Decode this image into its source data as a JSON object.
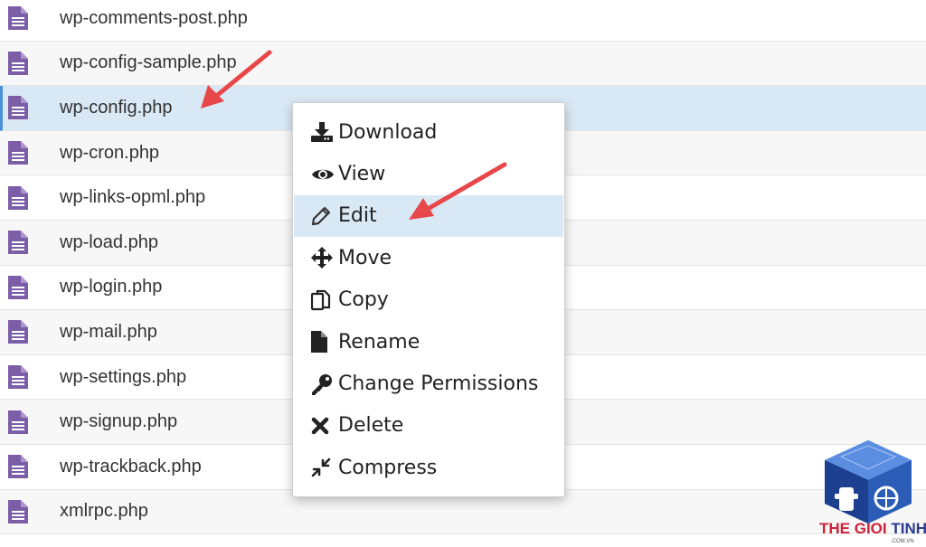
{
  "files": [
    {
      "name": "wp-comments-post.php",
      "selected": false
    },
    {
      "name": "wp-config-sample.php",
      "selected": false
    },
    {
      "name": "wp-config.php",
      "selected": true
    },
    {
      "name": "wp-cron.php",
      "selected": false
    },
    {
      "name": "wp-links-opml.php",
      "selected": false
    },
    {
      "name": "wp-load.php",
      "selected": false
    },
    {
      "name": "wp-login.php",
      "selected": false
    },
    {
      "name": "wp-mail.php",
      "selected": false
    },
    {
      "name": "wp-settings.php",
      "selected": false
    },
    {
      "name": "wp-signup.php",
      "selected": false
    },
    {
      "name": "wp-trackback.php",
      "selected": false
    },
    {
      "name": "xmlrpc.php",
      "selected": false
    }
  ],
  "context_menu": {
    "items": [
      {
        "label": "Download",
        "icon": "download-icon"
      },
      {
        "label": "View",
        "icon": "eye-icon"
      },
      {
        "label": "Edit",
        "icon": "pencil-icon",
        "hovered": true
      },
      {
        "label": "Move",
        "icon": "move-arrows-icon"
      },
      {
        "label": "Copy",
        "icon": "copy-icon"
      },
      {
        "label": "Rename",
        "icon": "file-icon"
      },
      {
        "label": "Change Permissions",
        "icon": "key-icon"
      },
      {
        "label": "Delete",
        "icon": "x-icon"
      },
      {
        "label": "Compress",
        "icon": "compress-icon"
      }
    ]
  },
  "watermark": {
    "brand_left": "THE GIOI ",
    "brand_right": "TINHOC",
    "domain": ".COM.VN"
  },
  "colors": {
    "file_icon": "#7b5ea7",
    "selected_row": "#d9e8f5",
    "annotation_arrow": "#e8474a",
    "brand_red": "#d0213a",
    "brand_blue": "#2b3b8f"
  }
}
